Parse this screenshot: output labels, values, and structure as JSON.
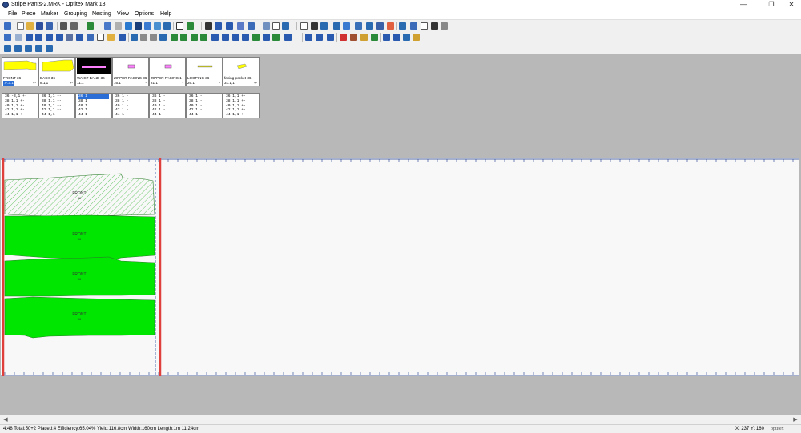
{
  "window": {
    "title": "Stripe Pants-2.MRK - Optitex Mark 18",
    "minimize": "—",
    "maximize": "❐",
    "close": "✕"
  },
  "menu": [
    "File",
    "Piece",
    "Marker",
    "Grouping",
    "Nesting",
    "View",
    "Options",
    "Help"
  ],
  "pieces": [
    {
      "name": "FRONT 36",
      "count": "7-:3:1",
      "plus": "+-",
      "thumb": "yellow-long",
      "selected": false,
      "count_highlight": true
    },
    {
      "name": "BACK 36",
      "count": "8:1,1",
      "plus": "+-",
      "thumb": "yellow-back",
      "selected": false
    },
    {
      "name": "WAIST BAND 36",
      "count": "11:1",
      "plus": "",
      "thumb": "band",
      "selected": true
    },
    {
      "name": "ZIPPER FACING 36",
      "count": "16:1",
      "plus": "-",
      "thumb": "small-pink",
      "selected": false
    },
    {
      "name": "ZIPPER FACING 1",
      "count": "21:1",
      "plus": "-",
      "thumb": "small-pink",
      "selected": false
    },
    {
      "name": "LOOPING 36",
      "count": "26:1",
      "plus": "-",
      "thumb": "thin-line",
      "selected": false
    },
    {
      "name": "facing pocket 36",
      "count": "31:1,1",
      "plus": "+-",
      "thumb": "yellow-pocket",
      "selected": false
    }
  ],
  "sizes": [
    {
      "rows": [
        "36  -3,1 +-",
        "38  1,1 +-",
        "40  1,1 +-",
        "42  1,1 +-",
        "44  1,1 +-"
      ]
    },
    {
      "rows": [
        "36  1,1 +-",
        "38  1,1 +-",
        "40  1,1 +-",
        "42  1,1 +-",
        "44  1,1 +-"
      ]
    },
    {
      "rows": [
        "36  1",
        "38  1",
        "40  1",
        "42  1",
        "44  1"
      ],
      "selected": true
    },
    {
      "rows": [
        "36  1  -",
        "38  1  -",
        "40  1  -",
        "42  1  -",
        "44  1  -"
      ]
    },
    {
      "rows": [
        "36  1  -",
        "38  1  -",
        "40  1  -",
        "42  1  -",
        "44  1  -"
      ]
    },
    {
      "rows": [
        "36  1  -",
        "38  1  -",
        "40  1  -",
        "42  1  -",
        "44  1  -"
      ]
    },
    {
      "rows": [
        "36  1,1 +-",
        "38  1,1 +-",
        "40  1,1 +-",
        "42  1,1 +-",
        "44  1,1 +-"
      ]
    }
  ],
  "marker": {
    "placed_pieces": [
      {
        "label": "FRONT",
        "size": "36",
        "style": "hatched"
      },
      {
        "label": "FRONT",
        "size": "36",
        "style": "solid"
      },
      {
        "label": "FRONT",
        "size": "36",
        "style": "solid"
      },
      {
        "label": "FRONT",
        "size": "36",
        "style": "solid"
      }
    ],
    "highlight_color": "#e0403c",
    "piece_color": "#00e600",
    "hatch_color": "#6cc86c"
  },
  "status": {
    "left": "4:48  Total:50+2  Placed:4  Efficiency:65.04%  Yield:116.8cm  Width:160cm  Length:1m 11.24cm",
    "coords": "X: 237  Y: 160",
    "brand": "optitex"
  }
}
